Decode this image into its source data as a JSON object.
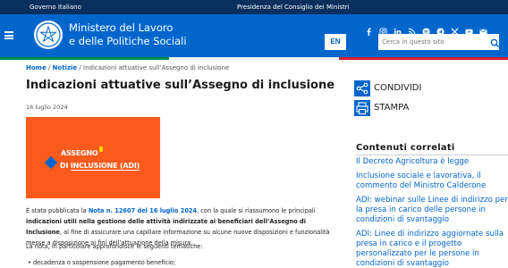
{
  "topbar": {
    "left_label": "Governo Italiano",
    "right_label": "Presidenza del Consiglio dei Ministri"
  },
  "header": {
    "brand_line1": "Ministero del Lavoro",
    "brand_line2": "e delle Politiche Sociali",
    "lang_label": "EN",
    "search_placeholder": "Cerca in questo sito",
    "social_icons": [
      "facebook-icon",
      "instagram-icon",
      "linkedin-icon",
      "rss-icon",
      "spotify-icon",
      "telegram-icon",
      "x-icon",
      "youtube-icon",
      "mail-icon"
    ]
  },
  "breadcrumb": {
    "home": "Home",
    "section": "Notizie",
    "current": "Indicazioni attuative sull’Assegno di inclusione",
    "separator": "/"
  },
  "article": {
    "title": "Indicazioni attuative sull’Assegno di inclusione",
    "date": "16 luglio 2024",
    "hero_line1": "ASSEGNO",
    "hero_line2a": "DI ",
    "hero_line2b": "INCLUSIONE (ADI)",
    "p1_a": "È stata pubblicata la ",
    "p1_link": "Nota n. 12607 del 16 luglio 2024",
    "p1_b": ", con la quale si riassumono le principali ",
    "p1_bold": "indicazioni utili nella gestione delle attività indirizzate ai beneficiari dell’Assegno di Inclusione",
    "p1_c": ", al fine di assicurare una capillare informazione su alcune nuove disposizioni e funzionalità messe a disposizione ai fini dell’attuazione della misura.",
    "p2": "La nota, in particolare approfondisce le seguenti tematiche:",
    "bullet1": "decadenza o sospensione pagamento beneficio;"
  },
  "actions": {
    "share_label": "CONDIVIDI",
    "print_label": "STAMPA"
  },
  "related": {
    "title": "Contenuti correlati",
    "items": [
      "Il Decreto Agricoltura è legge",
      "Inclusione sociale e lavorativa, il commento del Ministro Calderone",
      "ADI: webinar sulle Linee di indirizzo per la presa in carico delle persone in condizioni di svantaggio",
      "ADI: Linee di indirizzo aggiornate sulla presa in carico e il progetto personalizzato per le persone in condizioni di svantaggio"
    ]
  },
  "colors": {
    "topbar": "#0a2f5c",
    "header": "#0066cc",
    "hero": "#fa5a1c",
    "link": "#0066cc",
    "tricolor_green": "#008c45",
    "tricolor_white": "#f4f5f0",
    "tricolor_red": "#cd212a"
  }
}
